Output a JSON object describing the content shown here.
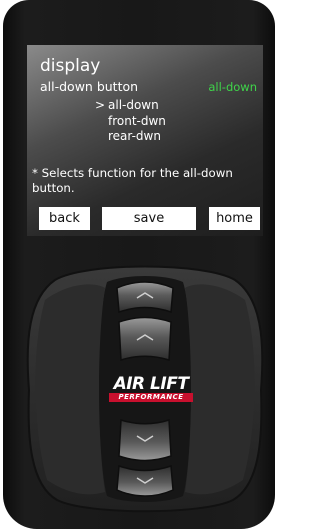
{
  "screen": {
    "title": "display",
    "setting_label": "all-down button",
    "current_value": "all-down",
    "menu": [
      {
        "cursor": ">",
        "label": "all-down"
      },
      {
        "cursor": "",
        "label": "front-dwn"
      },
      {
        "cursor": "",
        "label": "rear-dwn"
      }
    ],
    "help_text": "* Selects function for the all-down button.",
    "buttons": {
      "back": "back",
      "save": "save",
      "home": "home"
    }
  },
  "controller": {
    "logo_main": "AIR LIFT",
    "logo_sub": "PERFORMANCE",
    "buttons": [
      {
        "icon": "chevron-up-icon"
      },
      {
        "icon": "chevron-up-icon"
      },
      {
        "icon": "chevron-down-icon"
      },
      {
        "icon": "chevron-down-icon"
      }
    ]
  },
  "colors": {
    "current_value": "#3fd44a",
    "device_body": "#1a1a1a",
    "logo_red": "#c8102e"
  }
}
